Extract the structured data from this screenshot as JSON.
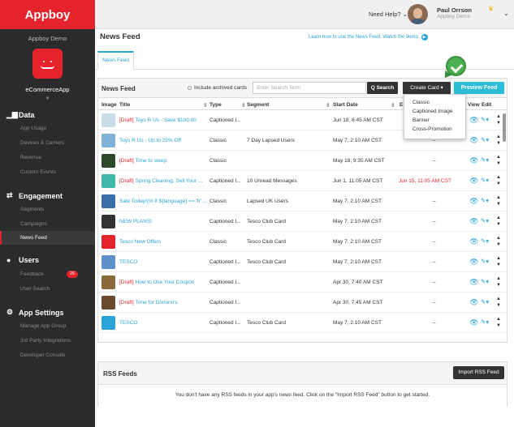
{
  "app": {
    "logo": "Appboy",
    "company": "Appboy Demo",
    "app_name": "eCommerceApp"
  },
  "sidebar": {
    "data": {
      "title": "Data",
      "items": [
        "App Usage",
        "Devices & Carriers",
        "Revenue",
        "Custom Events"
      ]
    },
    "engagement": {
      "title": "Engagement",
      "items": [
        "Segments",
        "Campaigns",
        "News Feed"
      ]
    },
    "users": {
      "title": "Users",
      "items": [
        "Feedback",
        "User Search"
      ],
      "feedback_badge": "26"
    },
    "settings": {
      "title": "App Settings",
      "items": [
        "Manage App Group",
        "3rd Party Integrations",
        "Developer Console"
      ]
    }
  },
  "topbar": {
    "help": "Need Help?",
    "user_name": "Paul Orrson",
    "user_company": "Appboy Demo"
  },
  "page": {
    "title": "News Feed",
    "learn_link": "Learn how to use the News Feed. Watch the demo.",
    "tab": "News Feed"
  },
  "panel": {
    "title": "News Feed",
    "archived_label": "Include archived cards",
    "search_placeholder": "Enter Search Term",
    "search_button": "Q Search",
    "create_button": "Create Card ▾",
    "preview_button": "Preview Feed"
  },
  "columns": {
    "image": "Image",
    "title": "Title",
    "type": "Type",
    "segment": "Segment",
    "start": "Start Date",
    "end": "E",
    "view": "View",
    "edit": "Edit"
  },
  "create_menu": [
    "Classic",
    "Captioned Image",
    "Banner",
    "Cross-Promotion"
  ],
  "rows": [
    {
      "draft": "[Draft]",
      "title": "  Toys R Us - Save $100.00",
      "type": "Captioned I...",
      "segment": "",
      "start": "Jun 18, 6:45 AM CST",
      "end": "--",
      "thumb_color": "#c8dde8"
    },
    {
      "draft": "",
      "title": "Toys R Us - Up to 25% Off",
      "type": "Classic",
      "segment": "7 Day Lapsed Users",
      "start": "May 7, 2:10 AM CST",
      "end": "--",
      "thumb_color": "#7fb2d8"
    },
    {
      "draft": "[Draft]",
      "title": "  Time to sleep",
      "type": "Classic",
      "segment": "",
      "start": "May 18, 9:35 AM CST",
      "end": "--",
      "thumb_color": "#2e4a2a"
    },
    {
      "draft": "[Draft]",
      "title": "  Spring Cleaning, Sell Your ...",
      "type": "Captioned I...",
      "segment": "10 Unread Messages",
      "start": "Jun 1, 11:05 AM CST",
      "end": "Jun 15, 11:05 AM CST",
      "thumb_color": "#3fb8a8",
      "end_red": true
    },
    {
      "draft": "",
      "title": "Sale Today!{% if ${language} == 'fr' ...",
      "type": "Classic",
      "segment": "Lapsed UK Users",
      "start": "May 7, 2:10 AM CST",
      "end": "--",
      "thumb_color": "#3a6ea8"
    },
    {
      "draft": "",
      "title": "NEW PLANS!",
      "type": "Captioned I...",
      "segment": "Tesco Club Card",
      "start": "May 7, 2:10 AM CST",
      "end": "--",
      "thumb_color": "#333333"
    },
    {
      "draft": "",
      "title": "Tesco New Offers",
      "type": "Classic",
      "segment": "Tesco Club Card",
      "start": "May 7, 2:10 AM CST",
      "end": "--",
      "thumb_color": "#e5232c"
    },
    {
      "draft": "",
      "title": "TESCO",
      "type": "Captioned I...",
      "segment": "Tesco Club Card",
      "start": "May 7, 2:10 AM CST",
      "end": "--",
      "thumb_color": "#5d8fc8"
    },
    {
      "draft": "[Draft]",
      "title": "  How to Use Your Coupon",
      "type": "Captioned I...",
      "segment": "",
      "start": "Apr 30, 7:40 AM CST",
      "end": "--",
      "thumb_color": "#8a6a3a"
    },
    {
      "draft": "[Draft]",
      "title": "  Time for Domino's",
      "type": "Captioned I...",
      "segment": "",
      "start": "Apr 30, 7:45 AM CST",
      "end": "--",
      "thumb_color": "#6a4a2a"
    },
    {
      "draft": "",
      "title": "TESCO",
      "type": "Captioned I...",
      "segment": "Tesco Club Card",
      "start": "May 7, 2:10 AM CST",
      "end": "--",
      "thumb_color": "#2aa3d8"
    }
  ],
  "rss": {
    "title": "RSS Feeds",
    "import_button": "Import RSS Feed",
    "empty_text": "You don't have any RSS feeds in your app's news feed. Click on the \"Import RSS Feed\" button to get started."
  }
}
